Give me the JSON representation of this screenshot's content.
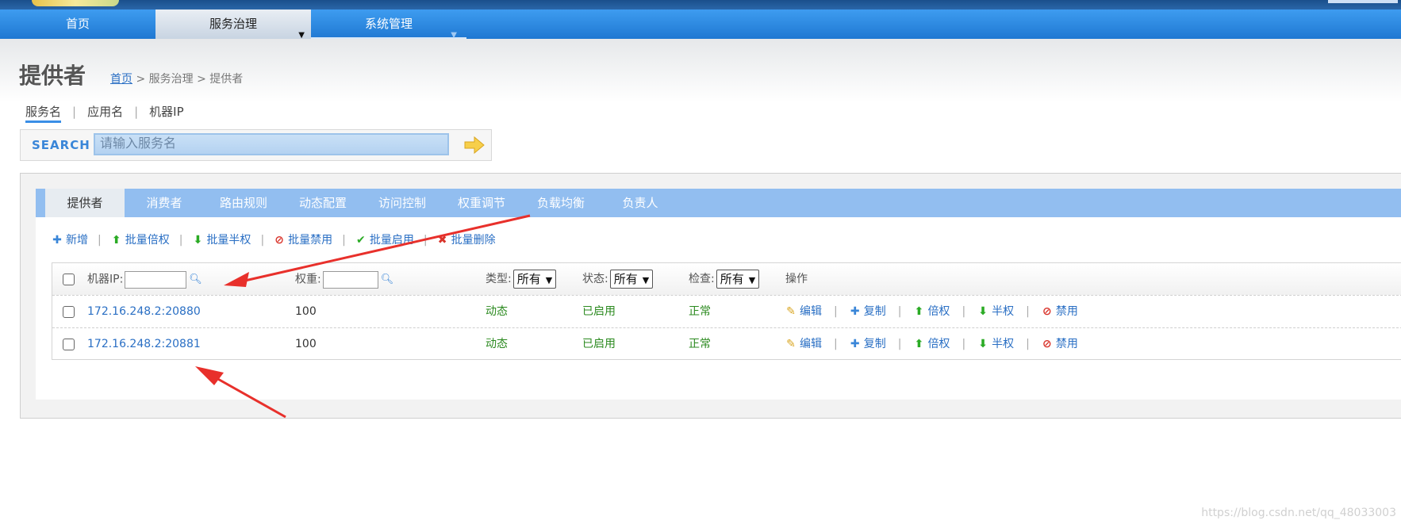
{
  "nav": {
    "items": [
      "首页",
      "服务治理",
      "系统管理"
    ]
  },
  "page": {
    "title": "提供者",
    "breadcrumb_home": "首页",
    "breadcrumb_rest": " > 服务治理 > 提供者"
  },
  "search": {
    "tabs": [
      "服务名",
      "应用名",
      "机器IP"
    ],
    "label": "SEARCH",
    "placeholder": "请输入服务名"
  },
  "tabs": [
    "提供者",
    "消费者",
    "路由规则",
    "动态配置",
    "访问控制",
    "权重调节",
    "负载均衡",
    "负责人"
  ],
  "actions": [
    {
      "label": "新增",
      "icon": "plus-icon"
    },
    {
      "label": "批量倍权",
      "icon": "arrow-up-icon"
    },
    {
      "label": "批量半权",
      "icon": "arrow-down-icon"
    },
    {
      "label": "批量禁用",
      "icon": "forbidden-icon"
    },
    {
      "label": "批量启用",
      "icon": "check-icon"
    },
    {
      "label": "批量删除",
      "icon": "cross-icon"
    }
  ],
  "table": {
    "headers": {
      "ip": "机器IP:",
      "weight": "权重:",
      "type": "类型:",
      "type_value": "所有",
      "status": "状态:",
      "status_value": "所有",
      "check": "检查:",
      "check_value": "所有",
      "ops": "操作"
    },
    "rows": [
      {
        "ip": "172.16.248.2:20880",
        "weight": "100",
        "type": "动态",
        "status": "已启用",
        "check": "正常"
      },
      {
        "ip": "172.16.248.2:20881",
        "weight": "100",
        "type": "动态",
        "status": "已启用",
        "check": "正常"
      }
    ],
    "row_ops": [
      {
        "label": "编辑",
        "icon": "pencil-icon"
      },
      {
        "label": "复制",
        "icon": "plus-icon"
      },
      {
        "label": "倍权",
        "icon": "arrow-up-icon"
      },
      {
        "label": "半权",
        "icon": "arrow-down-icon"
      },
      {
        "label": "禁用",
        "icon": "forbidden-icon"
      }
    ]
  },
  "colors": {
    "nav": "#2a86e0",
    "tabbar": "#92bef0",
    "link": "#2a6fc4",
    "green": "#2b8a1f",
    "annotation_arrow": "#e8302b"
  },
  "watermark": "https://blog.csdn.net/qq_48033003"
}
